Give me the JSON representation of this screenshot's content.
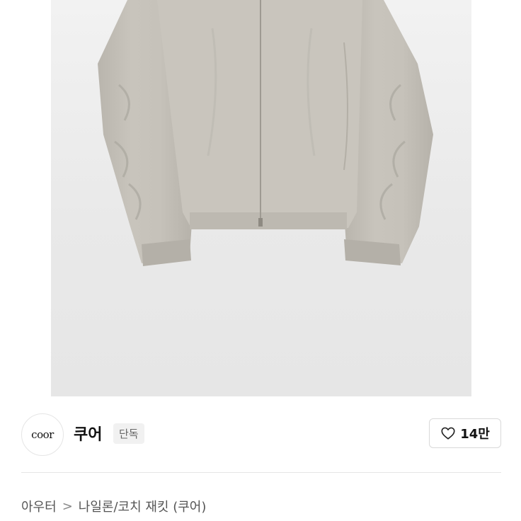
{
  "brand": {
    "logo_text": "coor",
    "name": "쿠어",
    "badge": "단독"
  },
  "like": {
    "icon": "heart-outline-icon",
    "count": "14만"
  },
  "breadcrumb": {
    "category": "아우터",
    "separator": ">",
    "subcategory": "나일론/코치 재킷 (쿠어)"
  },
  "colors": {
    "jacket": "#c3c0b8",
    "background": "#ebebeb",
    "divider": "#e6e6e6"
  }
}
